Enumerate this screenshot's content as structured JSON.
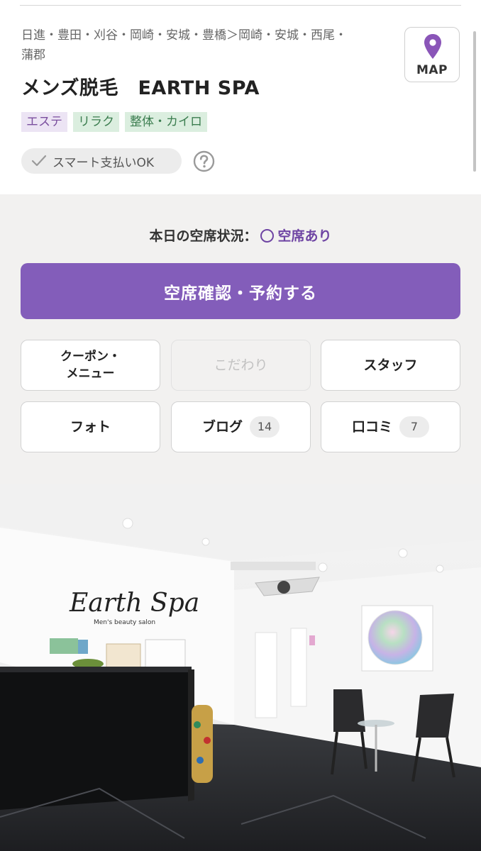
{
  "header": {
    "area_line1": "日進・豊田・刈谷・岡崎・安城・豊橋＞岡崎・安城・西尾・",
    "area_line2": "蒲郡",
    "title": "メンズ脱毛　EARTH SPA",
    "tags": [
      {
        "label": "エステ",
        "color": "purple"
      },
      {
        "label": "リラク",
        "color": "green"
      },
      {
        "label": "整体・カイロ",
        "color": "green"
      }
    ],
    "smart_pay": "スマート支払いOK",
    "help_icon": "question-circle-icon",
    "map_label": "MAP",
    "map_icon": "map-pin-icon"
  },
  "availability": {
    "label": "本日の空席状況：",
    "status": "空席あり"
  },
  "reserve_label": "空席確認・予約する",
  "menu_buttons": {
    "coupon_line1": "クーポン・",
    "coupon_line2": "メニュー",
    "kodawari": "こだわり",
    "staff": "スタッフ",
    "photo": "フォト",
    "blog": "ブログ",
    "blog_count": "14",
    "review": "口コミ",
    "review_count": "7"
  },
  "salon_photo": {
    "logo_text": "Earth Spa",
    "logo_subtext": "Men's beauty salon"
  },
  "colors": {
    "accent": "#835dba",
    "accent_dark": "#6e44a3",
    "tag_purple_bg": "#ece4f4",
    "tag_green_bg": "#dbeedf"
  }
}
